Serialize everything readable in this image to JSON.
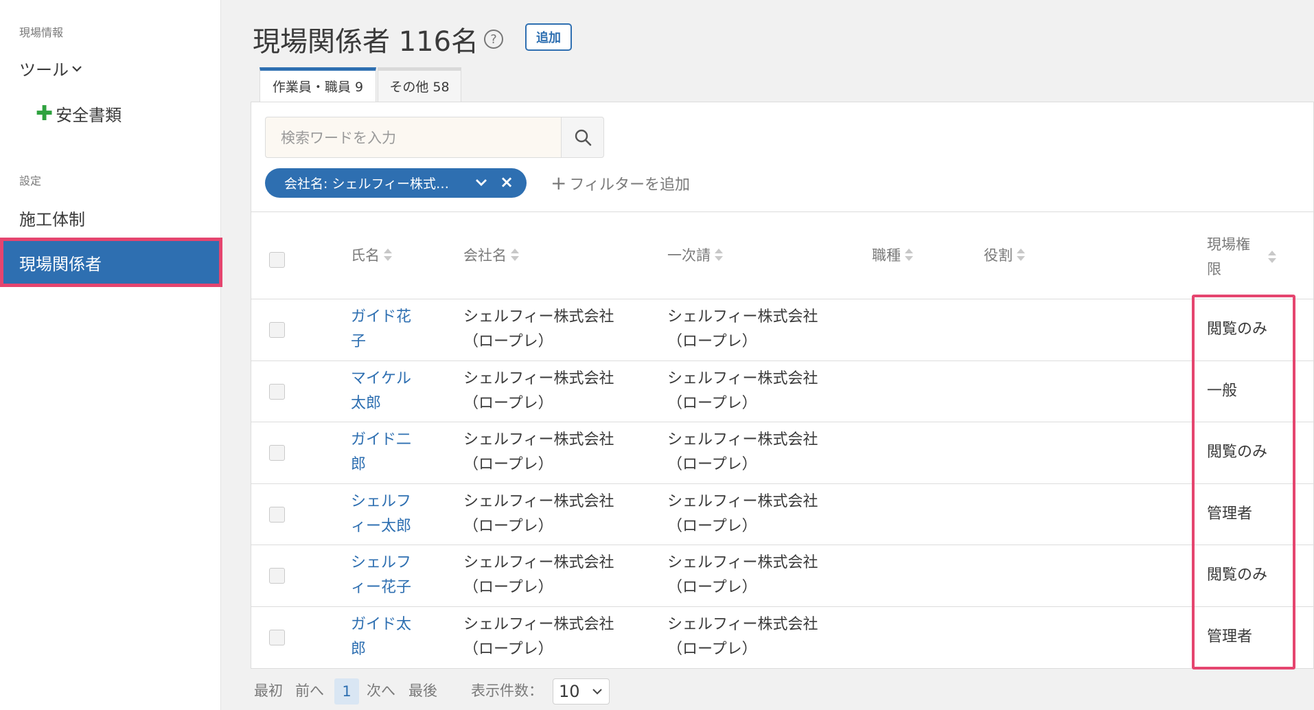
{
  "sidebar": {
    "section_site": "現場情報",
    "tools_label": "ツール",
    "safety_docs_label": "安全書類",
    "section_settings": "設定",
    "construction_label": "施工体制",
    "members_label": "現場関係者"
  },
  "header": {
    "title": "現場関係者 116名",
    "add_button": "追加"
  },
  "tabs": [
    {
      "label": "作業員・職員 9"
    },
    {
      "label": "その他 58"
    }
  ],
  "search": {
    "placeholder": "検索ワードを入力"
  },
  "filter": {
    "chip_label": "会社名: シェルフィー株式…",
    "add_filter_label": "フィルターを追加"
  },
  "table": {
    "columns": [
      "氏名",
      "会社名",
      "一次請",
      "職種",
      "役割",
      "現場権\n限"
    ],
    "rows": [
      {
        "name": "ガイド花\n子",
        "company": "シェルフィー株式会社\n（ロープレ）",
        "primary": "シェルフィー株式会社\n（ロープレ）",
        "permission": "閲覧のみ"
      },
      {
        "name": "マイケル\n太郎",
        "company": "シェルフィー株式会社\n（ロープレ）",
        "primary": "シェルフィー株式会社\n（ロープレ）",
        "permission": "一般"
      },
      {
        "name": "ガイド二\n郎",
        "company": "シェルフィー株式会社\n（ロープレ）",
        "primary": "シェルフィー株式会社\n（ロープレ）",
        "permission": "閲覧のみ"
      },
      {
        "name": "シェルフ\nィー太郎",
        "company": "シェルフィー株式会社\n（ロープレ）",
        "primary": "シェルフィー株式会社\n（ロープレ）",
        "permission": "管理者"
      },
      {
        "name": "シェルフ\nィー花子",
        "company": "シェルフィー株式会社\n（ロープレ）",
        "primary": "シェルフィー株式会社\n（ロープレ）",
        "permission": "閲覧のみ"
      },
      {
        "name": "ガイド太\n郎",
        "company": "シェルフィー株式会社\n（ロープレ）",
        "primary": "シェルフィー株式会社\n（ロープレ）",
        "permission": "管理者"
      }
    ]
  },
  "pagination": {
    "first": "最初",
    "prev": "前へ",
    "current": "1",
    "next": "次へ",
    "last": "最後",
    "per_page_label": "表示件数：",
    "per_page_value": "10"
  },
  "colors": {
    "accent": "#2e6fb1",
    "highlight": "#e5456f",
    "plus_green": "#2fa23f"
  }
}
